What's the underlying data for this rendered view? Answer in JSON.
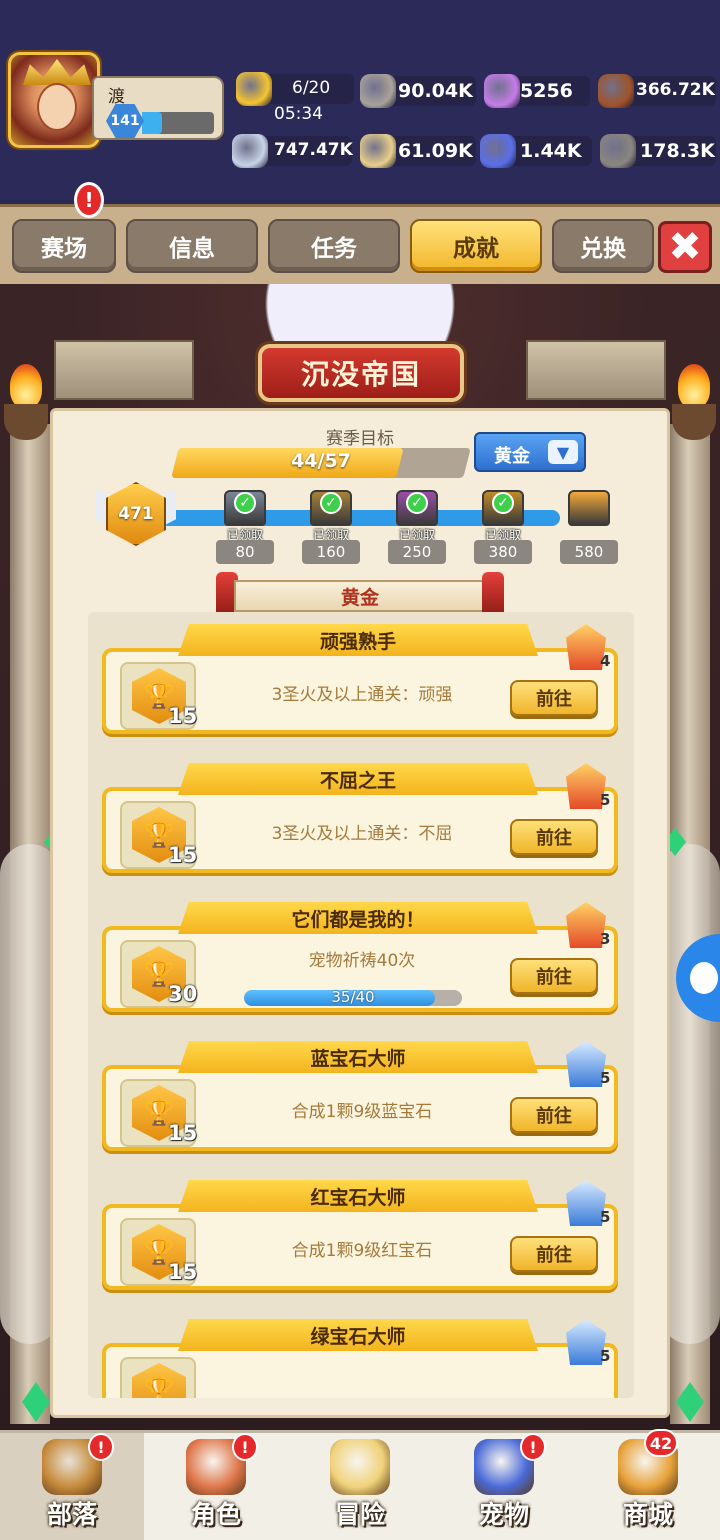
{
  "player": {
    "name": "渡",
    "level": "141",
    "xp_fraction": 0.28
  },
  "resources": [
    {
      "icon": "meat-stamina-icon",
      "value": "6/20",
      "sub": "05:34",
      "color": "#f6c431"
    },
    {
      "icon": "stone-ore-icon",
      "value": "90.04K",
      "color": "#a9a39b"
    },
    {
      "icon": "pearl-orb-icon",
      "value": "5256",
      "color": "#c57de8"
    },
    {
      "icon": "wood-logs-icon",
      "value": "366.72K",
      "color": "#a0542a"
    },
    {
      "icon": "bone-icon",
      "value": "747.47K",
      "color": "#c8d4e8"
    },
    {
      "icon": "egg-shell-icon",
      "value": "61.09K",
      "color": "#e8cf8a"
    },
    {
      "icon": "blue-crystal-icon",
      "value": "1.44K",
      "color": "#5a6fe8"
    },
    {
      "icon": "iron-ore-icon",
      "value": "178.3K",
      "color": "#8a8680"
    }
  ],
  "tabs": [
    {
      "label": "赛场",
      "active": false
    },
    {
      "label": "信息",
      "active": false
    },
    {
      "label": "任务",
      "active": false
    },
    {
      "label": "成就",
      "active": true
    },
    {
      "label": "兑换",
      "active": false
    }
  ],
  "tab_alert": "!",
  "close_symbol": "✖",
  "event_title": "沉没帝国",
  "season": {
    "label": "赛季目标",
    "progress_text": "44/57",
    "progress_fraction": 0.772,
    "tier": "黄金",
    "tier_arrow": "▼"
  },
  "score": "471",
  "milestones": [
    {
      "points": "80",
      "claimed": "已领取",
      "color": "#7b8698"
    },
    {
      "points": "160",
      "claimed": "已领取",
      "color": "#a8823a"
    },
    {
      "points": "250",
      "claimed": "已领取",
      "color": "#9a4fa8"
    },
    {
      "points": "380",
      "claimed": "已领取",
      "color": "#c28a2a"
    },
    {
      "points": "580",
      "claimed": "",
      "color": "#f3a93a"
    }
  ],
  "section_title": "黄金",
  "achievements": [
    {
      "title": "顽强熟手",
      "desc": "3圣火及以上通关：顽强",
      "points": "15",
      "rank": "4",
      "rank_color": "red",
      "button": "前往"
    },
    {
      "title": "不屈之王",
      "desc": "3圣火及以上通关：不屈",
      "points": "15",
      "rank": "5",
      "rank_color": "red",
      "button": "前往"
    },
    {
      "title": "它们都是我的！",
      "desc": "宠物祈祷40次",
      "points": "30",
      "rank": "3",
      "rank_color": "red",
      "button": "前往",
      "progress_text": "35/40",
      "progress_fraction": 0.875
    },
    {
      "title": "蓝宝石大师",
      "desc": "合成1颗9级蓝宝石",
      "points": "15",
      "rank": "5",
      "rank_color": "blue",
      "button": "前往"
    },
    {
      "title": "红宝石大师",
      "desc": "合成1颗9级红宝石",
      "points": "15",
      "rank": "5",
      "rank_color": "blue",
      "button": "前往"
    },
    {
      "title": "绿宝石大师",
      "desc": "",
      "points": "",
      "rank": "5",
      "rank_color": "blue",
      "button": ""
    }
  ],
  "bottom_nav": [
    {
      "label": "部落",
      "icon": "tribe-chief-icon",
      "alert": "!",
      "active": true
    },
    {
      "label": "角色",
      "icon": "hero-character-icon",
      "alert": "!",
      "active": false
    },
    {
      "label": "冒险",
      "icon": "adventure-map-icon",
      "alert": "",
      "active": false
    },
    {
      "label": "宠物",
      "icon": "pet-wolf-icon",
      "alert": "!",
      "active": false
    },
    {
      "label": "商城",
      "icon": "shop-bag-icon",
      "count": "42",
      "active": false
    }
  ]
}
